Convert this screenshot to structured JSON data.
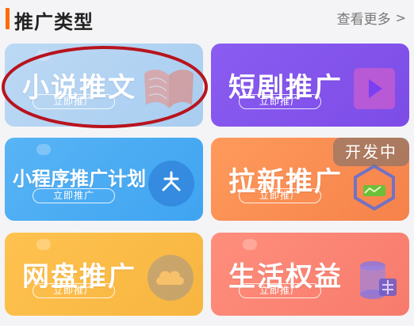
{
  "header": {
    "title": "推广类型",
    "more_label": "查看更多",
    "more_chevron": ">"
  },
  "cards": {
    "novel": {
      "name": "小说推文",
      "button": "立即推广",
      "icon": "book-icon"
    },
    "drama": {
      "name": "短剧推广",
      "button": "立即推广",
      "icon": "play-icon"
    },
    "mini": {
      "name": "小程序推广计划",
      "button": "立即推广",
      "icon": "snowflake-icon"
    },
    "lax": {
      "name": "拉新推广",
      "button": "立即推广",
      "icon": "chart-icon",
      "badge": "开发中"
    },
    "pan": {
      "name": "网盘推广",
      "button": "立即推广",
      "icon": "cloud-icon"
    },
    "life": {
      "name": "生活权益",
      "button": "立即推广",
      "icon": "coin-stack-icon"
    }
  },
  "colors": {
    "accent_bar": "#ff6a00",
    "novel": "#a9cdf0",
    "drama": "#7d4ce8",
    "mini": "#3fa4f1",
    "lax": "#f5824a",
    "pan": "#f7b540",
    "life": "#f77b6c",
    "annotation_ellipse": "#b8141e"
  }
}
